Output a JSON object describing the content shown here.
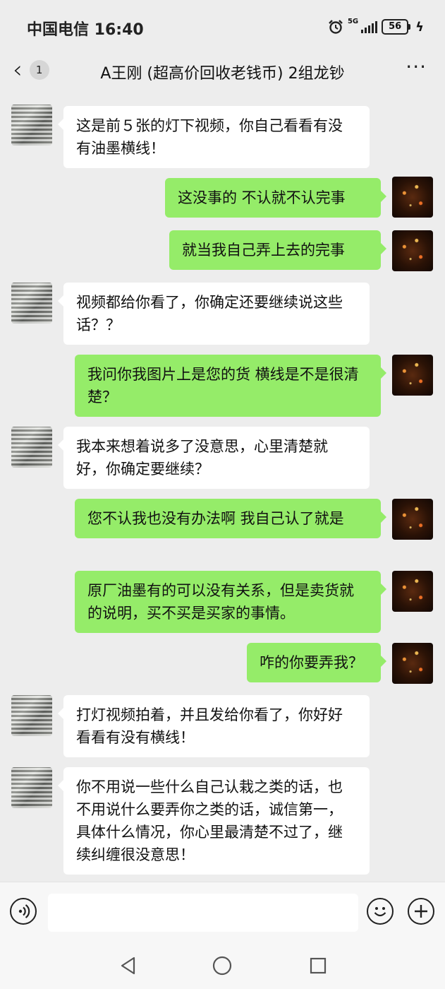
{
  "status_bar": {
    "carrier_time": "中国电信 16:40",
    "network": "5G",
    "battery": "56"
  },
  "header": {
    "back_count": "1",
    "title": "A王刚 (超高价回收老钱币) 2组龙钞",
    "more": "···"
  },
  "messages": [
    {
      "side": "left",
      "text": "这是前５张的灯下视频，你自己看看有没有油墨横线！"
    },
    {
      "side": "right",
      "text": "这没事的 不认就不认完事"
    },
    {
      "side": "right",
      "text": "就当我自己弄上去的完事"
    },
    {
      "side": "left",
      "text": "视频都给你看了，你确定还要继续说这些话？？"
    },
    {
      "side": "right",
      "text": "我问你我图片上是您的货 横线是不是很清楚？"
    },
    {
      "side": "left",
      "text": "我本来想着说多了没意思，心里清楚就好，你确定要继续？"
    },
    {
      "side": "right",
      "text": "您不认我也没有办法啊 我自己认了就是"
    },
    {
      "side": "right",
      "text": "原厂油墨有的可以没有关系，但是卖货就的说明，买不买是买家的事情。"
    },
    {
      "side": "right",
      "text": "咋的你要弄我？"
    },
    {
      "side": "left",
      "text": "打灯视频拍着，并且发给你看了，你好好看看有没有横线！"
    },
    {
      "side": "left",
      "text": "你不用说一些什么自己认栽之类的话，也不用说什么要弄你之类的话，诚信第一，具体什么情况，你心里最清楚不过了，继续纠缠很没意思！"
    }
  ],
  "input": {
    "value": "",
    "placeholder": ""
  },
  "colors": {
    "background": "#ededed",
    "bubble_self": "#95ec69",
    "bubble_other": "#ffffff"
  },
  "icons": [
    "alarm-icon",
    "signal-icon",
    "battery-icon",
    "charge-icon",
    "back-chevron-icon",
    "more-icon",
    "voice-icon",
    "emoji-icon",
    "plus-icon",
    "nav-back-icon",
    "nav-home-icon",
    "nav-recent-icon"
  ]
}
